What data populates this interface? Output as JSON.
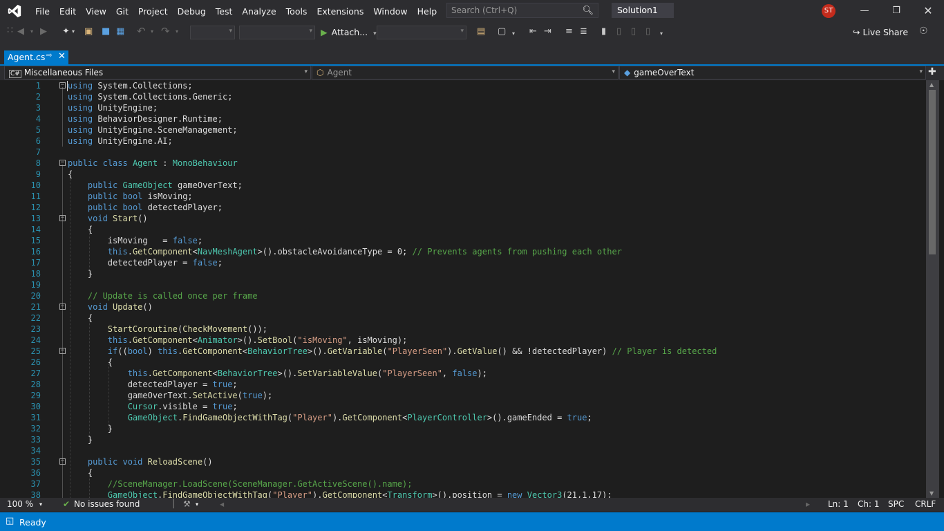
{
  "menu": [
    "File",
    "Edit",
    "View",
    "Git",
    "Project",
    "Debug",
    "Test",
    "Analyze",
    "Tools",
    "Extensions",
    "Window",
    "Help"
  ],
  "search": {
    "placeholder": "Search (Ctrl+Q)"
  },
  "solution_name": "Solution1",
  "user_initials": "ST",
  "toolbar": {
    "attach_label": "Attach...",
    "live_share_label": "Live Share"
  },
  "tab": {
    "label": "Agent.cs"
  },
  "navbar": {
    "project": "Miscellaneous Files",
    "type": "Agent",
    "member": "gameOverText"
  },
  "code_lines": [
    {
      "n": "1",
      "fold": "minus",
      "html": "<span class=\"kw\">using</span> System.Collections;"
    },
    {
      "n": "2",
      "html": "<span class=\"kw\">using</span> System.Collections.Generic;"
    },
    {
      "n": "3",
      "html": "<span class=\"kw\">using</span> UnityEngine;"
    },
    {
      "n": "4",
      "html": "<span class=\"kw\">using</span> BehaviorDesigner.Runtime;"
    },
    {
      "n": "5",
      "html": "<span class=\"kw\">using</span> UnityEngine.SceneManagement;"
    },
    {
      "n": "6",
      "html": "<span class=\"kw\">using</span> UnityEngine.AI;"
    },
    {
      "n": "7",
      "html": ""
    },
    {
      "n": "8",
      "fold": "minus",
      "html": "<span class=\"kw\">public</span> <span class=\"kw\">class</span> <span class=\"ty\">Agent</span> : <span class=\"ty\">MonoBehaviour</span>"
    },
    {
      "n": "9",
      "html": "{"
    },
    {
      "n": "10",
      "html": "    <span class=\"kw\">public</span> <span class=\"ty\">GameObject</span> gameOverText;"
    },
    {
      "n": "11",
      "html": "    <span class=\"kw\">public</span> <span class=\"kw\">bool</span> isMoving;"
    },
    {
      "n": "12",
      "html": "    <span class=\"kw\">public</span> <span class=\"kw\">bool</span> detectedPlayer;"
    },
    {
      "n": "13",
      "fold": "minus",
      "html": "    <span class=\"kw\">void</span> <span class=\"mt\">Start</span>()"
    },
    {
      "n": "14",
      "html": "    {"
    },
    {
      "n": "15",
      "html": "        isMoving   = <span class=\"kw\">false</span>;"
    },
    {
      "n": "16",
      "html": "        <span class=\"kw\">this</span>.<span class=\"mt\">GetComponent</span>&lt;<span class=\"ty\">NavMeshAgent</span>&gt;().obstacleAvoidanceType = 0; <span class=\"cm\">// Prevents agents from pushing each other</span>"
    },
    {
      "n": "17",
      "html": "        detectedPlayer = <span class=\"kw\">false</span>;"
    },
    {
      "n": "18",
      "html": "    }"
    },
    {
      "n": "19",
      "html": ""
    },
    {
      "n": "20",
      "html": "    <span class=\"cm\">// Update is called once per frame</span>"
    },
    {
      "n": "21",
      "fold": "minus",
      "html": "    <span class=\"kw\">void</span> <span class=\"mt\">Update</span>()"
    },
    {
      "n": "22",
      "html": "    {"
    },
    {
      "n": "23",
      "html": "        <span class=\"mt\">StartCoroutine</span>(<span class=\"mt\">CheckMovement</span>());"
    },
    {
      "n": "24",
      "html": "        <span class=\"kw\">this</span>.<span class=\"mt\">GetComponent</span>&lt;<span class=\"ty\">Animator</span>&gt;().<span class=\"mt\">SetBool</span>(<span class=\"str\">\"isMoving\"</span>, isMoving);"
    },
    {
      "n": "25",
      "fold": "minus",
      "html": "        <span class=\"kw\">if</span>((<span class=\"kw\">bool</span>) <span class=\"kw\">this</span>.<span class=\"mt\">GetComponent</span>&lt;<span class=\"ty\">BehaviorTree</span>&gt;().<span class=\"mt\">GetVariable</span>(<span class=\"str\">\"PlayerSeen\"</span>).<span class=\"mt\">GetValue</span>() &amp;&amp; !detectedPlayer) <span class=\"cm\">// Player is detected</span>"
    },
    {
      "n": "26",
      "html": "        {"
    },
    {
      "n": "27",
      "html": "            <span class=\"kw\">this</span>.<span class=\"mt\">GetComponent</span>&lt;<span class=\"ty\">BehaviorTree</span>&gt;().<span class=\"mt\">SetVariableValue</span>(<span class=\"str\">\"PlayerSeen\"</span>, <span class=\"kw\">false</span>);"
    },
    {
      "n": "28",
      "html": "            detectedPlayer = <span class=\"kw\">true</span>;"
    },
    {
      "n": "29",
      "html": "            gameOverText.<span class=\"mt\">SetActive</span>(<span class=\"kw\">true</span>);"
    },
    {
      "n": "30",
      "html": "            <span class=\"ty\">Cursor</span>.visible = <span class=\"kw\">true</span>;"
    },
    {
      "n": "31",
      "html": "            <span class=\"ty\">GameObject</span>.<span class=\"mt\">FindGameObjectWithTag</span>(<span class=\"str\">\"Player\"</span>).<span class=\"mt\">GetComponent</span>&lt;<span class=\"ty\">PlayerController</span>&gt;().gameEnded = <span class=\"kw\">true</span>;"
    },
    {
      "n": "32",
      "html": "        }"
    },
    {
      "n": "33",
      "html": "    }"
    },
    {
      "n": "34",
      "html": ""
    },
    {
      "n": "35",
      "fold": "minus",
      "html": "    <span class=\"kw\">public</span> <span class=\"kw\">void</span> <span class=\"mt\">ReloadScene</span>()"
    },
    {
      "n": "36",
      "html": "    {"
    },
    {
      "n": "37",
      "html": "        <span class=\"cm\">//SceneManager.LoadScene(SceneManager.GetActiveScene().name);</span>"
    },
    {
      "n": "38",
      "html": "        <span class=\"ty\">GameObject</span>.<span class=\"mt\">FindGameObjectWithTag</span>(<span class=\"str\">\"Player\"</span>).<span class=\"mt\">GetComponent</span>&lt;<span class=\"ty\">Transform</span>&gt;().position = <span class=\"kw\">new</span> <span class=\"ty\">Vector3</span>(21,1,17);"
    }
  ],
  "infobar": {
    "zoom": "100 %",
    "issues": "No issues found",
    "line": "Ln: 1",
    "col": "Ch: 1",
    "ws": "SPC",
    "eol": "CRLF"
  },
  "status": {
    "ready": "Ready"
  },
  "colors": {
    "accent": "#007acc",
    "keyword": "#569cd6",
    "type": "#4ec9b0",
    "string": "#d69d85",
    "comment": "#57a64a",
    "line_number": "#2b91af"
  }
}
